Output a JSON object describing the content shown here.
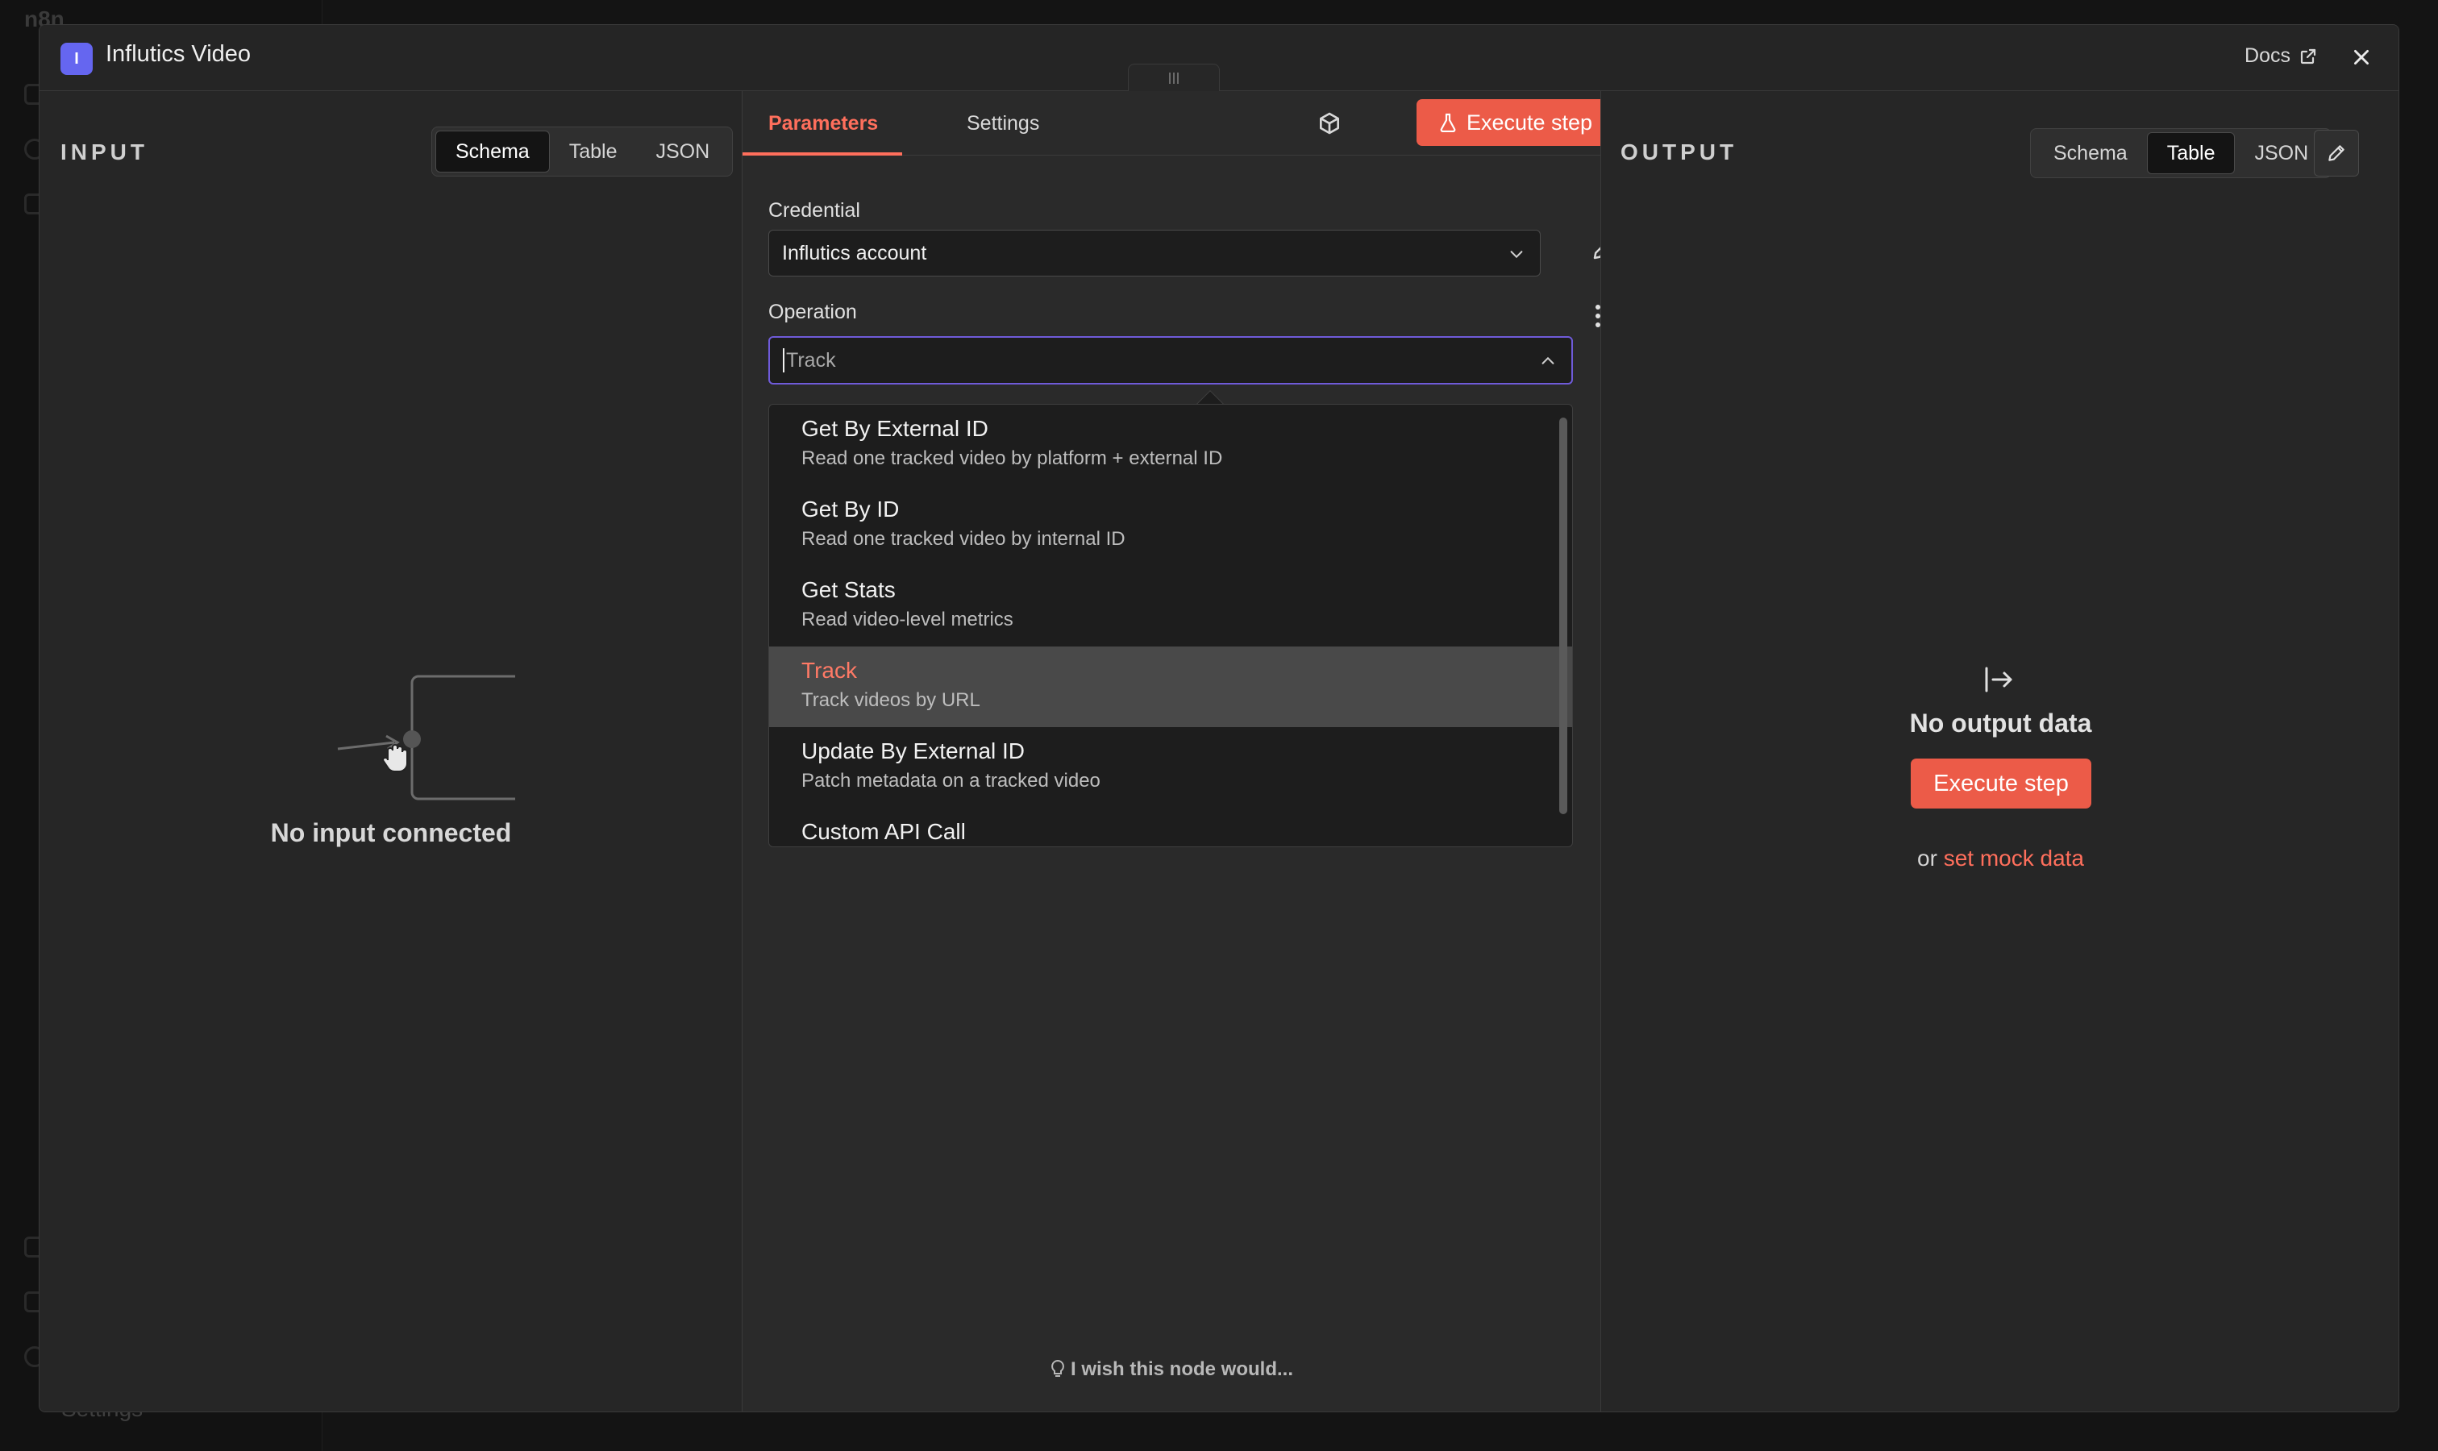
{
  "background": {
    "logo_text": "n8n",
    "settings_label": "Settings"
  },
  "modal": {
    "title": "Influtics Video",
    "node_icon_letter": "I",
    "docs_label": "Docs",
    "input": {
      "label": "INPUT",
      "view_tabs": [
        "Schema",
        "Table",
        "JSON"
      ],
      "active_tab": "Schema",
      "empty_message": "No input connected"
    },
    "parameters": {
      "tabs": [
        "Parameters",
        "Settings"
      ],
      "active_tab": "Parameters",
      "execute_label": "Execute step",
      "credential_label": "Credential",
      "credential_value": "Influtics account",
      "operation_label": "Operation",
      "operation_value": "Track",
      "operations": [
        {
          "title": "Get By External ID",
          "description": "Read one tracked video by platform + external ID"
        },
        {
          "title": "Get By ID",
          "description": "Read one tracked video by internal ID"
        },
        {
          "title": "Get Stats",
          "description": "Read video-level metrics"
        },
        {
          "title": "Track",
          "description": "Track videos by URL"
        },
        {
          "title": "Update By External ID",
          "description": "Patch metadata on a tracked video"
        },
        {
          "title": "Custom API Call",
          "description": ""
        }
      ],
      "selected_operation": "Track",
      "wish_text": "I wish this node would..."
    },
    "output": {
      "label": "OUTPUT",
      "view_tabs": [
        "Schema",
        "Table",
        "JSON"
      ],
      "active_tab": "Table",
      "empty_message": "No output data",
      "execute_label": "Execute step",
      "mock_prefix": "or",
      "mock_link": "set mock data"
    }
  },
  "colors": {
    "accent": "#ec5b48",
    "accent_text": "#ff6f5c",
    "focus_border": "#6f5bd9",
    "node_icon": "#6566f0"
  },
  "icons": [
    "external-link-icon",
    "close-icon",
    "drag-handle-icon",
    "cube-icon",
    "flask-icon",
    "chevron-down-icon",
    "chevron-up-icon",
    "pencil-icon",
    "kebab-menu-icon",
    "lightbulb-icon",
    "output-arrow-icon",
    "hand-cursor-icon"
  ]
}
